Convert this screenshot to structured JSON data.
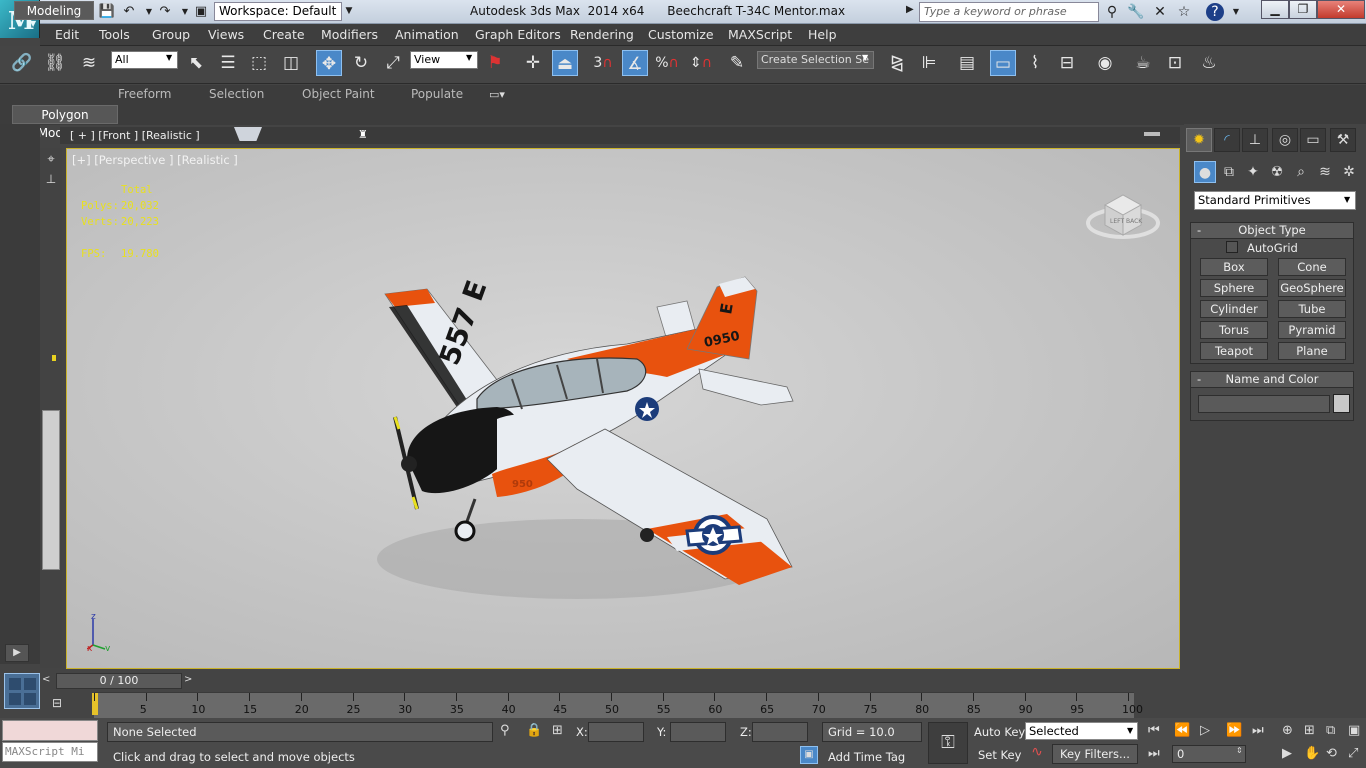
{
  "title_bar": {
    "workspace_label": "Workspace: Default",
    "app_title": "Autodesk 3ds Max  2014 x64",
    "file_name": "Beechcraft T-34C Mentor.max",
    "search_placeholder": "Type a keyword or phrase"
  },
  "menu": [
    "Edit",
    "Tools",
    "Group",
    "Views",
    "Create",
    "Modifiers",
    "Animation",
    "Graph Editors",
    "Rendering",
    "Customize",
    "MAXScript",
    "Help"
  ],
  "toolbar": {
    "filter_value": "All",
    "coord_value": "View",
    "selection_set_value": "Create Selection Se",
    "snap_label": "3"
  },
  "ribbon": {
    "tabs": [
      "Modeling",
      "Freeform",
      "Selection",
      "Object Paint",
      "Populate"
    ],
    "panel": "Polygon Modeling"
  },
  "viewport": {
    "top_label": "[ + ] [Front ] [Realistic ]",
    "label": "[+] [Perspective ] [Realistic ]",
    "stats": {
      "total_label": "Total",
      "polys_label": "Polys:",
      "polys_value": "20,032",
      "verts_label": "Verts:",
      "verts_value": "20,223",
      "fps_label": "FPS:",
      "fps_value": "19.780"
    },
    "airplane": {
      "wing_code": "557 E",
      "tail_code": "0950",
      "tail_letter": "E",
      "nose_code": "950",
      "colors": {
        "orange": "#e8520e",
        "white": "#e9edf2",
        "black": "#161616"
      }
    },
    "viewcube_labels": [
      "LEFT",
      "BACK"
    ],
    "axis": {
      "z": "z",
      "x": "x",
      "y": "y"
    }
  },
  "command_panel": {
    "dropdown": "Standard Primitives",
    "object_type_title": "Object Type",
    "autogrid_label": "AutoGrid",
    "buttons": [
      "Box",
      "Cone",
      "Sphere",
      "GeoSphere",
      "Cylinder",
      "Tube",
      "Torus",
      "Pyramid",
      "Teapot",
      "Plane"
    ],
    "name_color_title": "Name and Color"
  },
  "timeline": {
    "frame_display": "0 / 100",
    "ticks": [
      "0",
      "5",
      "10",
      "15",
      "20",
      "25",
      "30",
      "35",
      "40",
      "45",
      "50",
      "55",
      "60",
      "65",
      "70",
      "75",
      "80",
      "85",
      "90",
      "95",
      "100"
    ]
  },
  "status": {
    "maxscript_label": "MAXScript Mi",
    "selection": "None Selected",
    "prompt": "Click and drag to select and move objects",
    "x_label": "X:",
    "y_label": "Y:",
    "z_label": "Z:",
    "grid": "Grid = 10.0",
    "add_time_tag": "Add Time Tag",
    "auto_key": "Auto Key",
    "set_key": "Set Key",
    "key_mode": "Selected",
    "key_filters": "Key Filters...",
    "current_frame": "0"
  }
}
